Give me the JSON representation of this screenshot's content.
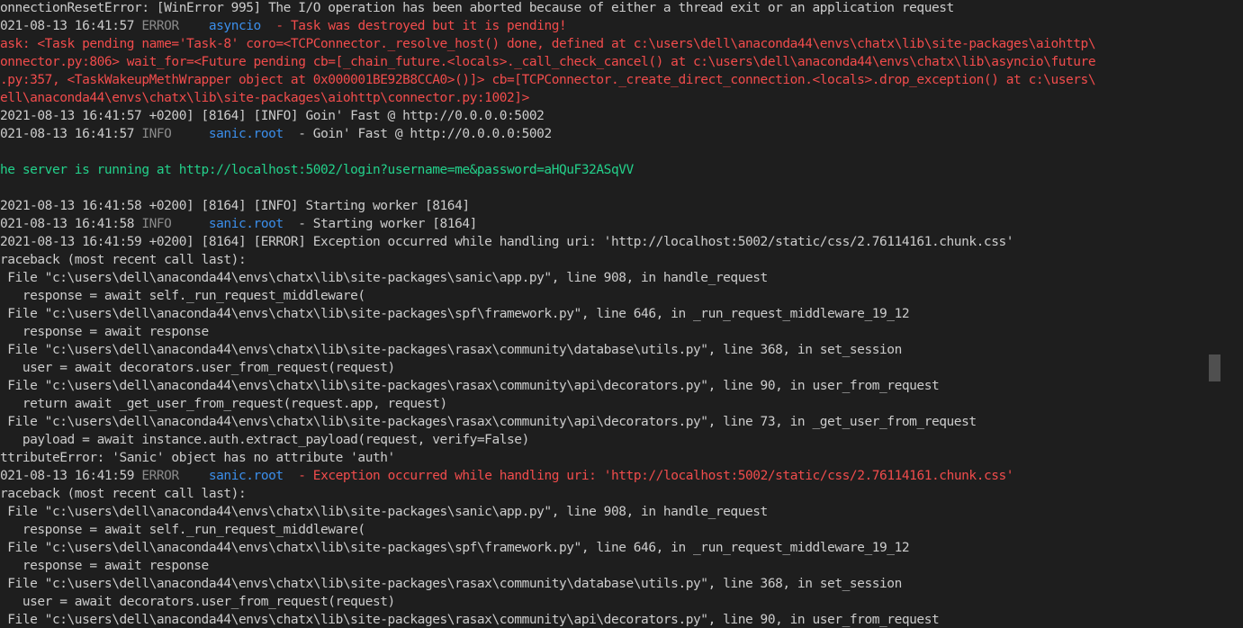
{
  "colors": {
    "background": "#1e1e1e",
    "text": "#cccccc",
    "error_red": "#f14c4c",
    "link_green": "#23d18b",
    "level_gray": "#8a8a8a",
    "logger_blue": "#3b8eea"
  },
  "terminal": {
    "lines": [
      {
        "segments": [
          {
            "text": "onnectionResetError: [WinError 995] The I/O operation has been aborted because of either a thread exit or an application request",
            "color": "t"
          }
        ]
      },
      {
        "segments": [
          {
            "text": "021-08-13 16:41:57 ",
            "color": "t"
          },
          {
            "text": "ERROR",
            "color": "gr"
          },
          {
            "text": "    ",
            "color": "t"
          },
          {
            "text": "asyncio",
            "color": "b"
          },
          {
            "text": "  - Task was destroyed but it is pending!",
            "color": "r"
          }
        ]
      },
      {
        "segments": [
          {
            "text": "ask: <Task pending name='Task-8' coro=<TCPConnector._resolve_host() done, defined at c:\\users\\dell\\anaconda44\\envs\\chatx\\lib\\site-packages\\aiohttp\\",
            "color": "r"
          }
        ]
      },
      {
        "segments": [
          {
            "text": "onnector.py:806> wait_for=<Future pending cb=[_chain_future.<locals>._call_check_cancel() at c:\\users\\dell\\anaconda44\\envs\\chatx\\lib\\asyncio\\future",
            "color": "r"
          }
        ]
      },
      {
        "segments": [
          {
            "text": ".py:357, <TaskWakeupMethWrapper object at 0x000001BE92B8CCA0>()]> cb=[TCPConnector._create_direct_connection.<locals>.drop_exception() at c:\\users\\",
            "color": "r"
          }
        ]
      },
      {
        "segments": [
          {
            "text": "ell\\anaconda44\\envs\\chatx\\lib\\site-packages\\aiohttp\\connector.py:1002]>",
            "color": "r"
          }
        ]
      },
      {
        "segments": [
          {
            "text": "2021-08-13 16:41:57 +0200] [8164] [INFO] Goin' Fast @ http://0.0.0.0:5002",
            "color": "t"
          }
        ]
      },
      {
        "segments": [
          {
            "text": "021-08-13 16:41:57 ",
            "color": "t"
          },
          {
            "text": "INFO",
            "color": "gr"
          },
          {
            "text": "     ",
            "color": "t"
          },
          {
            "text": "sanic.root",
            "color": "b"
          },
          {
            "text": "  - Goin' Fast @ http://0.0.0.0:5002",
            "color": "t"
          }
        ]
      },
      {
        "segments": [
          {
            "text": "",
            "color": "t"
          }
        ]
      },
      {
        "segments": [
          {
            "text": "he server is running at http://localhost:5002/login?username=me&password=aHQuF32ASqVV",
            "color": "g"
          }
        ]
      },
      {
        "segments": [
          {
            "text": "",
            "color": "t"
          }
        ]
      },
      {
        "segments": [
          {
            "text": "2021-08-13 16:41:58 +0200] [8164] [INFO] Starting worker [8164]",
            "color": "t"
          }
        ]
      },
      {
        "segments": [
          {
            "text": "021-08-13 16:41:58 ",
            "color": "t"
          },
          {
            "text": "INFO",
            "color": "gr"
          },
          {
            "text": "     ",
            "color": "t"
          },
          {
            "text": "sanic.root",
            "color": "b"
          },
          {
            "text": "  - Starting worker [8164]",
            "color": "t"
          }
        ]
      },
      {
        "segments": [
          {
            "text": "2021-08-13 16:41:59 +0200] [8164] [ERROR] Exception occurred while handling uri: 'http://localhost:5002/static/css/2.76114161.chunk.css'",
            "color": "t"
          }
        ]
      },
      {
        "segments": [
          {
            "text": "raceback (most recent call last):",
            "color": "t"
          }
        ]
      },
      {
        "segments": [
          {
            "text": " File \"c:\\users\\dell\\anaconda44\\envs\\chatx\\lib\\site-packages\\sanic\\app.py\", line 908, in handle_request",
            "color": "t"
          }
        ]
      },
      {
        "segments": [
          {
            "text": "   response = await self._run_request_middleware(",
            "color": "t"
          }
        ]
      },
      {
        "segments": [
          {
            "text": " File \"c:\\users\\dell\\anaconda44\\envs\\chatx\\lib\\site-packages\\spf\\framework.py\", line 646, in _run_request_middleware_19_12",
            "color": "t"
          }
        ]
      },
      {
        "segments": [
          {
            "text": "   response = await response",
            "color": "t"
          }
        ]
      },
      {
        "segments": [
          {
            "text": " File \"c:\\users\\dell\\anaconda44\\envs\\chatx\\lib\\site-packages\\rasax\\community\\database\\utils.py\", line 368, in set_session",
            "color": "t"
          }
        ]
      },
      {
        "segments": [
          {
            "text": "   user = await decorators.user_from_request(request)",
            "color": "t"
          }
        ]
      },
      {
        "segments": [
          {
            "text": " File \"c:\\users\\dell\\anaconda44\\envs\\chatx\\lib\\site-packages\\rasax\\community\\api\\decorators.py\", line 90, in user_from_request",
            "color": "t"
          }
        ]
      },
      {
        "segments": [
          {
            "text": "   return await _get_user_from_request(request.app, request)",
            "color": "t"
          }
        ]
      },
      {
        "segments": [
          {
            "text": " File \"c:\\users\\dell\\anaconda44\\envs\\chatx\\lib\\site-packages\\rasax\\community\\api\\decorators.py\", line 73, in _get_user_from_request",
            "color": "t"
          }
        ]
      },
      {
        "segments": [
          {
            "text": "   payload = await instance.auth.extract_payload(request, verify=False)",
            "color": "t"
          }
        ]
      },
      {
        "segments": [
          {
            "text": "ttributeError: 'Sanic' object has no attribute 'auth'",
            "color": "t"
          }
        ]
      },
      {
        "segments": [
          {
            "text": "021-08-13 16:41:59 ",
            "color": "t"
          },
          {
            "text": "ERROR",
            "color": "gr"
          },
          {
            "text": "    ",
            "color": "t"
          },
          {
            "text": "sanic.root",
            "color": "b"
          },
          {
            "text": "  - Exception occurred while handling uri: 'http://localhost:5002/static/css/2.76114161.chunk.css'",
            "color": "r"
          }
        ]
      },
      {
        "segments": [
          {
            "text": "raceback (most recent call last):",
            "color": "t"
          }
        ]
      },
      {
        "segments": [
          {
            "text": " File \"c:\\users\\dell\\anaconda44\\envs\\chatx\\lib\\site-packages\\sanic\\app.py\", line 908, in handle_request",
            "color": "t"
          }
        ]
      },
      {
        "segments": [
          {
            "text": "   response = await self._run_request_middleware(",
            "color": "t"
          }
        ]
      },
      {
        "segments": [
          {
            "text": " File \"c:\\users\\dell\\anaconda44\\envs\\chatx\\lib\\site-packages\\spf\\framework.py\", line 646, in _run_request_middleware_19_12",
            "color": "t"
          }
        ]
      },
      {
        "segments": [
          {
            "text": "   response = await response",
            "color": "t"
          }
        ]
      },
      {
        "segments": [
          {
            "text": " File \"c:\\users\\dell\\anaconda44\\envs\\chatx\\lib\\site-packages\\rasax\\community\\database\\utils.py\", line 368, in set_session",
            "color": "t"
          }
        ]
      },
      {
        "segments": [
          {
            "text": "   user = await decorators.user_from_request(request)",
            "color": "t"
          }
        ]
      },
      {
        "segments": [
          {
            "text": " File \"c:\\users\\dell\\anaconda44\\envs\\chatx\\lib\\site-packages\\rasax\\community\\api\\decorators.py\", line 90, in user_from_request",
            "color": "t"
          }
        ]
      }
    ]
  }
}
